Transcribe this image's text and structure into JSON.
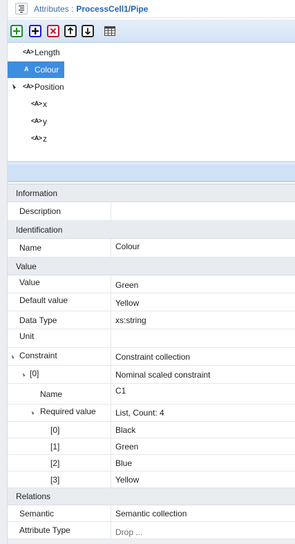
{
  "window": {
    "title_label": "Attributes :",
    "title_path": "ProcessCell1/Pipe"
  },
  "toolbar": {
    "buttons": [
      {
        "name": "add",
        "icon": "plus-icon",
        "color": "#1d8a2f"
      },
      {
        "name": "add-child",
        "icon": "add-child-icon",
        "color": "#1a1ad2"
      },
      {
        "name": "delete",
        "icon": "delete-x-icon",
        "color": "#c8102e"
      },
      {
        "name": "move-up",
        "icon": "arrow-up-icon"
      },
      {
        "name": "move-down",
        "icon": "arrow-down-icon"
      },
      {
        "name": "table-view",
        "icon": "table-icon"
      }
    ]
  },
  "tree": {
    "items": [
      {
        "label": "Length",
        "icon": "<A>"
      },
      {
        "label": "Colour",
        "icon": "A",
        "selected": true
      },
      {
        "label": "Position",
        "icon": "<A>",
        "expanded": true
      },
      {
        "label": "x",
        "icon": "<A>"
      },
      {
        "label": "y",
        "icon": "<A>"
      },
      {
        "label": "z",
        "icon": "<A>"
      }
    ],
    "selected_color": "#3d8de0"
  },
  "properties": {
    "information": {
      "header": "Information",
      "description": {
        "name": "Description",
        "value": ""
      }
    },
    "identification": {
      "header": "Identification",
      "name": {
        "name": "Name",
        "value": "Colour"
      }
    },
    "value": {
      "header": "Value",
      "value": {
        "name": "Value",
        "value": "Green"
      },
      "default_value": {
        "name": "Default value",
        "value": "Yellow"
      },
      "data_type": {
        "name": "Data Type",
        "value": "xs:string"
      },
      "unit": {
        "name": "Unit",
        "value": ""
      },
      "constraint": {
        "name": "Constraint",
        "value": "Constraint collection"
      },
      "constraint_0": {
        "name": "[0]",
        "value": "Nominal scaled constraint"
      },
      "constraint_0_name": {
        "name": "Name",
        "value": "C1"
      },
      "required_value": {
        "name": "Required value",
        "value": "List, Count: 4"
      },
      "rv": [
        {
          "name": "[0]",
          "value": "Black"
        },
        {
          "name": "[1]",
          "value": "Green"
        },
        {
          "name": "[2]",
          "value": "Blue"
        },
        {
          "name": "[3]",
          "value": "Yellow"
        }
      ]
    },
    "relations": {
      "header": "Relations",
      "semantic": {
        "name": "Semantic",
        "value": "Semantic collection"
      },
      "attribute_type": {
        "name": "Attribute Type",
        "value": "Drop ..."
      }
    }
  }
}
